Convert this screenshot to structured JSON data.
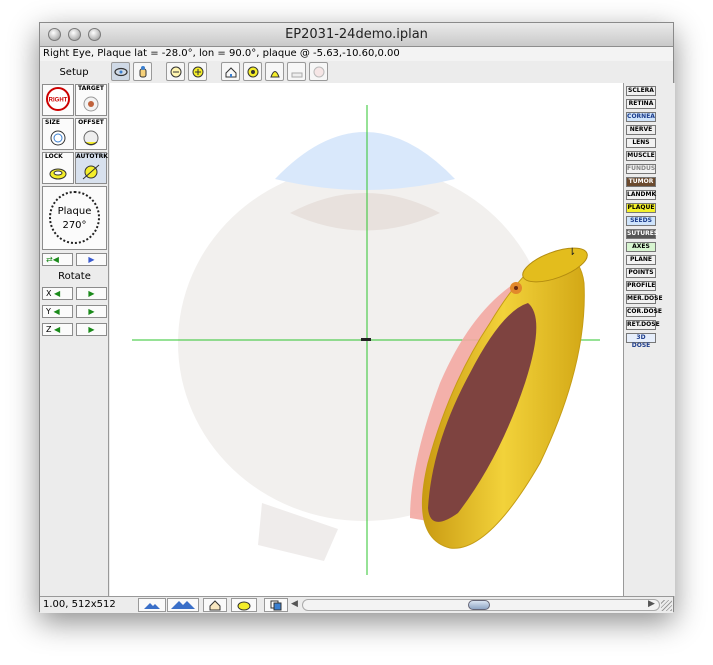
{
  "window": {
    "title": "EP2031-24demo.iplan"
  },
  "info": {
    "text": "Right Eye, Plaque lat = -28.0°, lon = 90.0°, plaque @ -5.63,-10.60,0.00"
  },
  "setup": {
    "label": "Setup",
    "right_btn": "RIGHT",
    "target_btn": "TARGET",
    "size_btn": "SIZE",
    "offset_btn": "OFFSET",
    "lock_btn": "LOCK",
    "autotrk_btn": "AUTOTRK"
  },
  "dial": {
    "label": "Plaque",
    "value": "270°"
  },
  "rotate": {
    "label": "Rotate",
    "axes": [
      "X",
      "Y",
      "Z"
    ]
  },
  "layers": [
    {
      "label": "SCLERA",
      "color": "#f2f2f2"
    },
    {
      "label": "RETINA",
      "color": "#f2f2f2"
    },
    {
      "label": "CORNEA",
      "color": "#cfe4fb"
    },
    {
      "label": "NERVE",
      "color": "#eeeeee"
    },
    {
      "label": "LENS",
      "color": "#f2f2f2"
    },
    {
      "label": "MUSCLE",
      "color": "#f2f2f2"
    },
    {
      "label": "FUNDUS",
      "color": "#f2f2f2"
    },
    {
      "label": "TUMOR",
      "color": "#6b4a2e"
    },
    {
      "label": "LANDMK",
      "color": "#f2f2f2"
    },
    {
      "label": "PLAQUE",
      "color": "#f4f12a"
    },
    {
      "label": "SEEDS",
      "color": "#cfe4fb"
    },
    {
      "label": "SUTURES",
      "color": "#555555"
    },
    {
      "label": "AXES",
      "color": "#d7f5d0"
    },
    {
      "label": "PLANE",
      "color": "#f2f2f2"
    },
    {
      "label": "POINTS",
      "color": "#f2f2f2"
    },
    {
      "label": "PROFILE",
      "color": "#f2f2f2"
    },
    {
      "label": "MER.DOSE",
      "color": "#f2f2f2"
    },
    {
      "label": "COR.DOSE",
      "color": "#f2f2f2"
    },
    {
      "label": "RET.DOSE",
      "color": "#f2f2f2"
    },
    {
      "label": "3D DOSE",
      "color": "#e6eefb"
    }
  ],
  "status": {
    "zoom": "1.00, 512x512"
  },
  "colors": {
    "axis": "#2ec52e",
    "plaque": "#e3bd1d",
    "tumor": "#7e4340",
    "cornea": "#d7e8fb",
    "sclera": "#f1eeec"
  }
}
